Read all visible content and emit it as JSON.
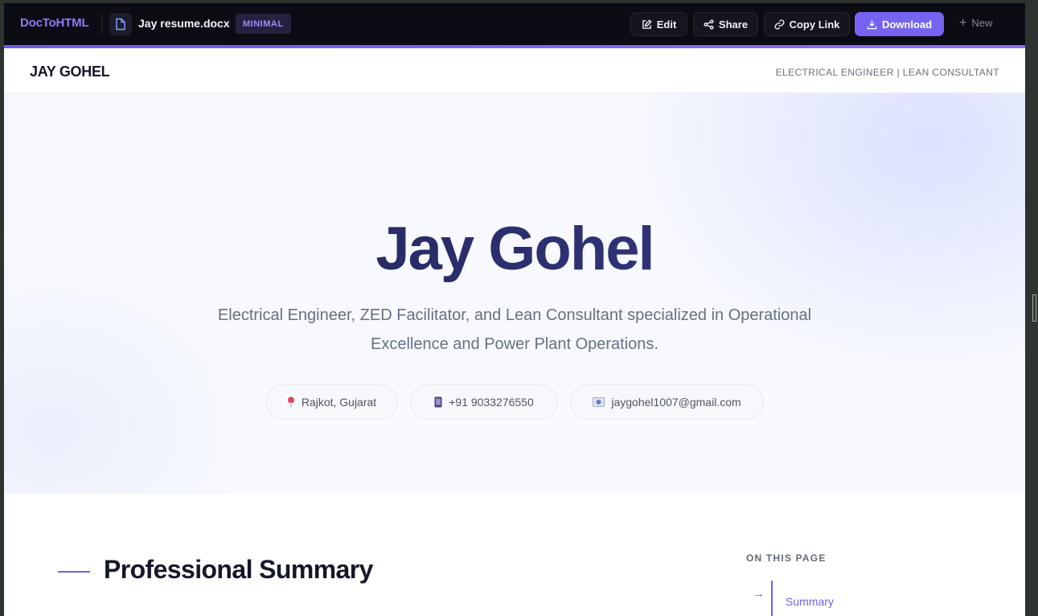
{
  "app": {
    "logo": "DocToHTML",
    "file_name": "Jay resume.docx",
    "theme_badge": "MINIMAL"
  },
  "toolbar": {
    "edit_label": "Edit",
    "share_label": "Share",
    "copy_link_label": "Copy Link",
    "download_label": "Download",
    "new_label": "New"
  },
  "resume_header": {
    "name": "JAY GOHEL",
    "role": "ELECTRICAL ENGINEER | LEAN CONSULTANT"
  },
  "hero": {
    "title": "Jay Gohel",
    "subtitle": "Electrical Engineer, ZED Facilitator, and Lean Consultant specialized in Operational Excellence and Power Plant Operations.",
    "location": "Rajkot, Gujarat",
    "phone": "+91 9033276550",
    "email": "jaygohel1007@gmail.com"
  },
  "content": {
    "section_title": "Professional Summary",
    "toc_heading": "ON THIS PAGE",
    "toc_items": [
      "Summary"
    ]
  },
  "colors": {
    "accent": "#7664f0",
    "appbar_bg": "#0c0c14",
    "title_gradient_start": "#1d2150",
    "title_gradient_end": "#3a3d8c"
  },
  "icons": {
    "file": "file-icon",
    "edit": "edit-icon",
    "share": "share-icon",
    "copy_link": "link-icon",
    "download": "download-icon",
    "new": "plus-icon",
    "location": "pin-icon",
    "phone": "phone-icon",
    "email": "email-icon",
    "toc": "arrow-right-icon"
  }
}
